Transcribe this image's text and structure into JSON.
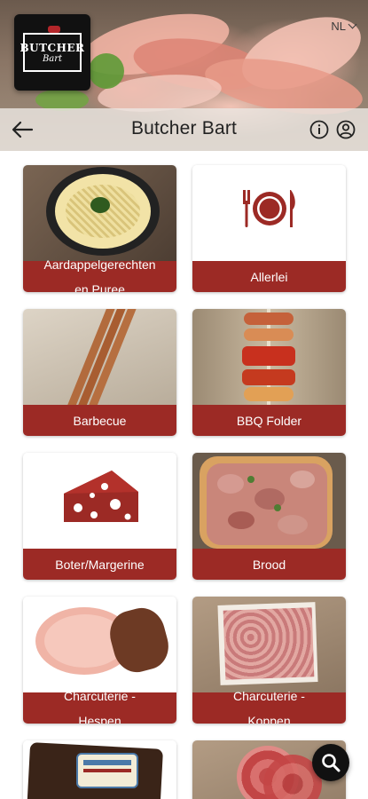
{
  "app": {
    "title": "Butcher Bart",
    "language": "NL"
  },
  "logo": {
    "line1": "BUTCHER",
    "line2": "Bart"
  },
  "colors": {
    "accent": "#9c2a25",
    "fab": "#111111"
  },
  "categories": [
    {
      "label1": "Aardappelgerechten",
      "label2": "en Puree",
      "art": "potato-dish"
    },
    {
      "label1": "Allerlei",
      "label2": "",
      "art": "plate-cutlery-icon"
    },
    {
      "label1": "Barbecue",
      "label2": "",
      "art": "sausages"
    },
    {
      "label1": "BBQ Folder",
      "label2": "",
      "art": "skewer"
    },
    {
      "label1": "Boter/Margerine",
      "label2": "",
      "art": "cheese-icon"
    },
    {
      "label1": "Brood",
      "label2": "",
      "art": "pizza-bread"
    },
    {
      "label1": "Charcuterie -",
      "label2": "Hespen",
      "art": "ham"
    },
    {
      "label1": "Charcuterie -",
      "label2": "Koppen",
      "art": "cold-cuts"
    },
    {
      "label1": "",
      "label2": "",
      "art": "pate"
    },
    {
      "label1": "",
      "label2": "",
      "art": "salami"
    }
  ],
  "icons": {
    "back": "arrow-left-icon",
    "info": "info-icon",
    "account": "account-icon",
    "search": "search-icon"
  }
}
